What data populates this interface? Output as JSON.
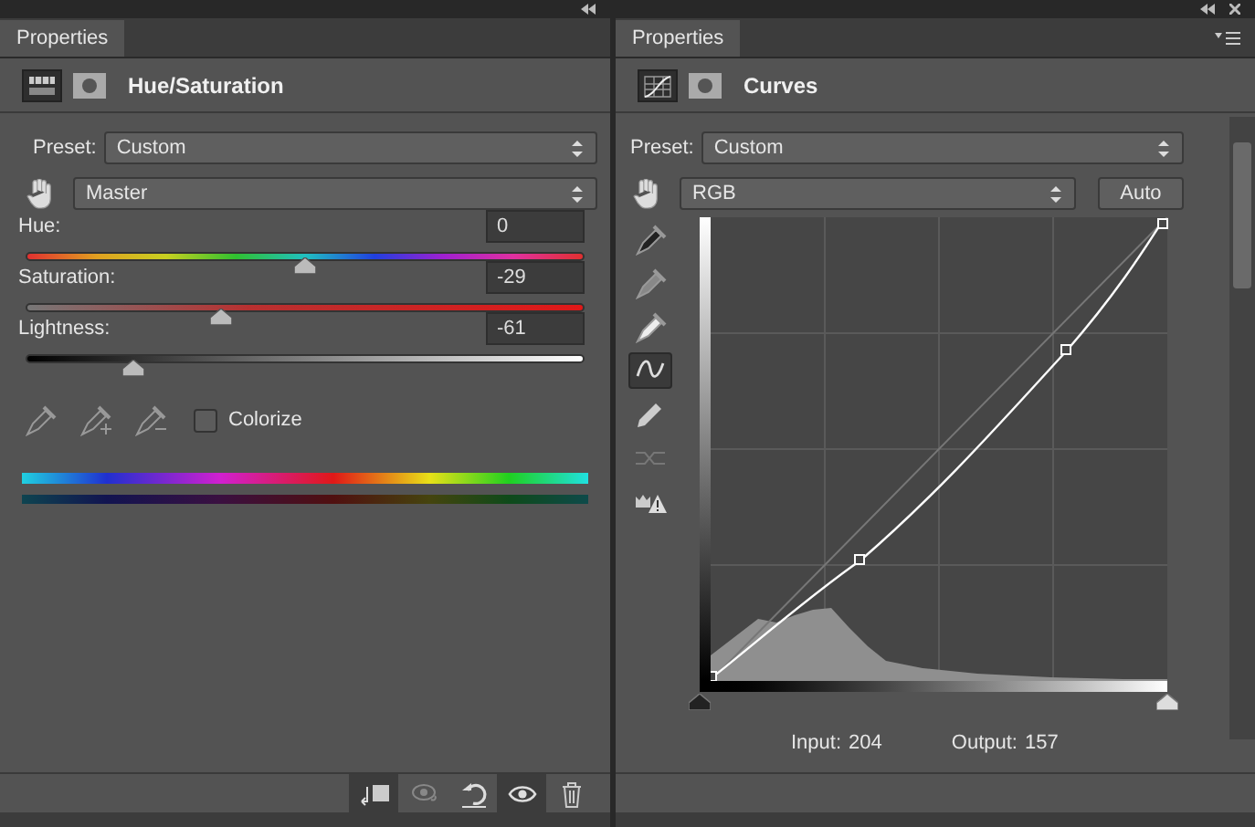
{
  "hue_saturation_panel": {
    "tab": "Properties",
    "title": "Hue/Saturation",
    "preset_label": "Preset:",
    "preset": "Custom",
    "channel": "Master",
    "sliders": [
      {
        "kind": "hue",
        "label": "Hue:",
        "value": "0",
        "level": 0.5
      },
      {
        "kind": "saturation",
        "label": "Saturation:",
        "value": "-29",
        "level": 0.35
      },
      {
        "kind": "lightness",
        "label": "Lightness:",
        "value": "-61",
        "level": 0.19
      }
    ],
    "colorize": {
      "label": "Colorize",
      "checked": false
    },
    "toolbar": [
      {
        "kind": "clip",
        "selected": true
      },
      {
        "kind": "view-previous",
        "selected": false
      },
      {
        "kind": "reset",
        "selected": false
      },
      {
        "kind": "visibility",
        "selected": true
      },
      {
        "kind": "delete",
        "selected": false
      }
    ]
  },
  "curves_panel": {
    "tab": "Properties",
    "title": "Curves",
    "preset_label": "Preset:",
    "preset": "Custom",
    "channel": "RGB",
    "auto_button": "Auto",
    "tools": [
      {
        "kind": "black-point",
        "selected": false
      },
      {
        "kind": "gray-point",
        "selected": false
      },
      {
        "kind": "white-point",
        "selected": false
      },
      {
        "kind": "curve",
        "selected": true
      },
      {
        "kind": "pencil",
        "selected": false
      },
      {
        "kind": "smooth",
        "selected": false
      },
      {
        "kind": "clipping",
        "selected": false
      }
    ],
    "input_sliders": [
      {
        "kind": "black",
        "level": 0
      },
      {
        "kind": "white",
        "level": 1
      }
    ],
    "input_label": "Input:",
    "input_value": "204",
    "output_label": "Output:",
    "output_value": "157"
  }
}
